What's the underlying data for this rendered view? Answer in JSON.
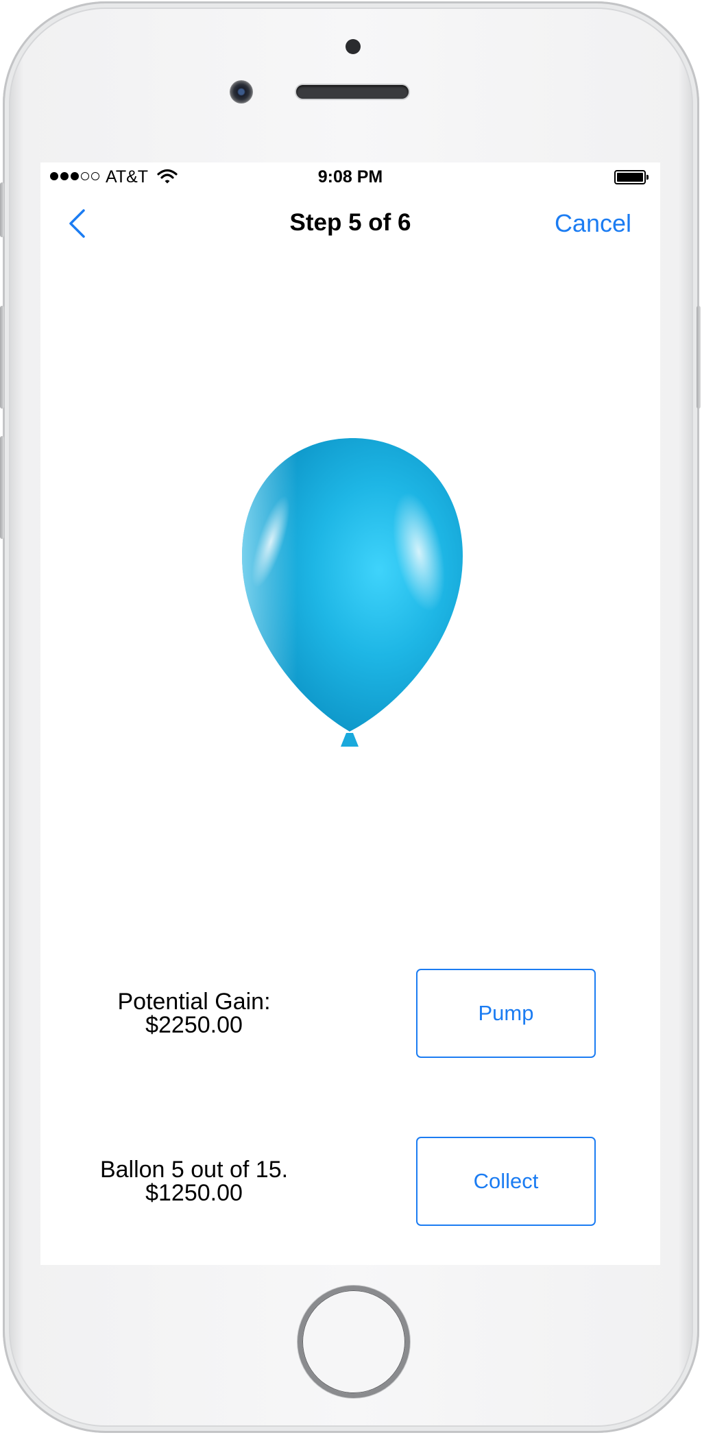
{
  "status_bar": {
    "carrier": "AT&T",
    "time": "9:08 PM",
    "signal_bars_filled": 3,
    "signal_bars_total": 5
  },
  "nav": {
    "back_icon": "chevron-left-icon",
    "title": "Step 5 of 6",
    "cancel_label": "Cancel"
  },
  "balloon": {
    "icon": "balloon-icon",
    "color": "#1fb6e6"
  },
  "gain": {
    "line1": "Potential Gain:",
    "line2": "$2250.00",
    "button_label": "Pump"
  },
  "collect": {
    "line1": "Ballon 5 out of 15.",
    "line2": "$1250.00",
    "button_label": "Collect"
  },
  "colors": {
    "accent": "#1b7cf2"
  }
}
